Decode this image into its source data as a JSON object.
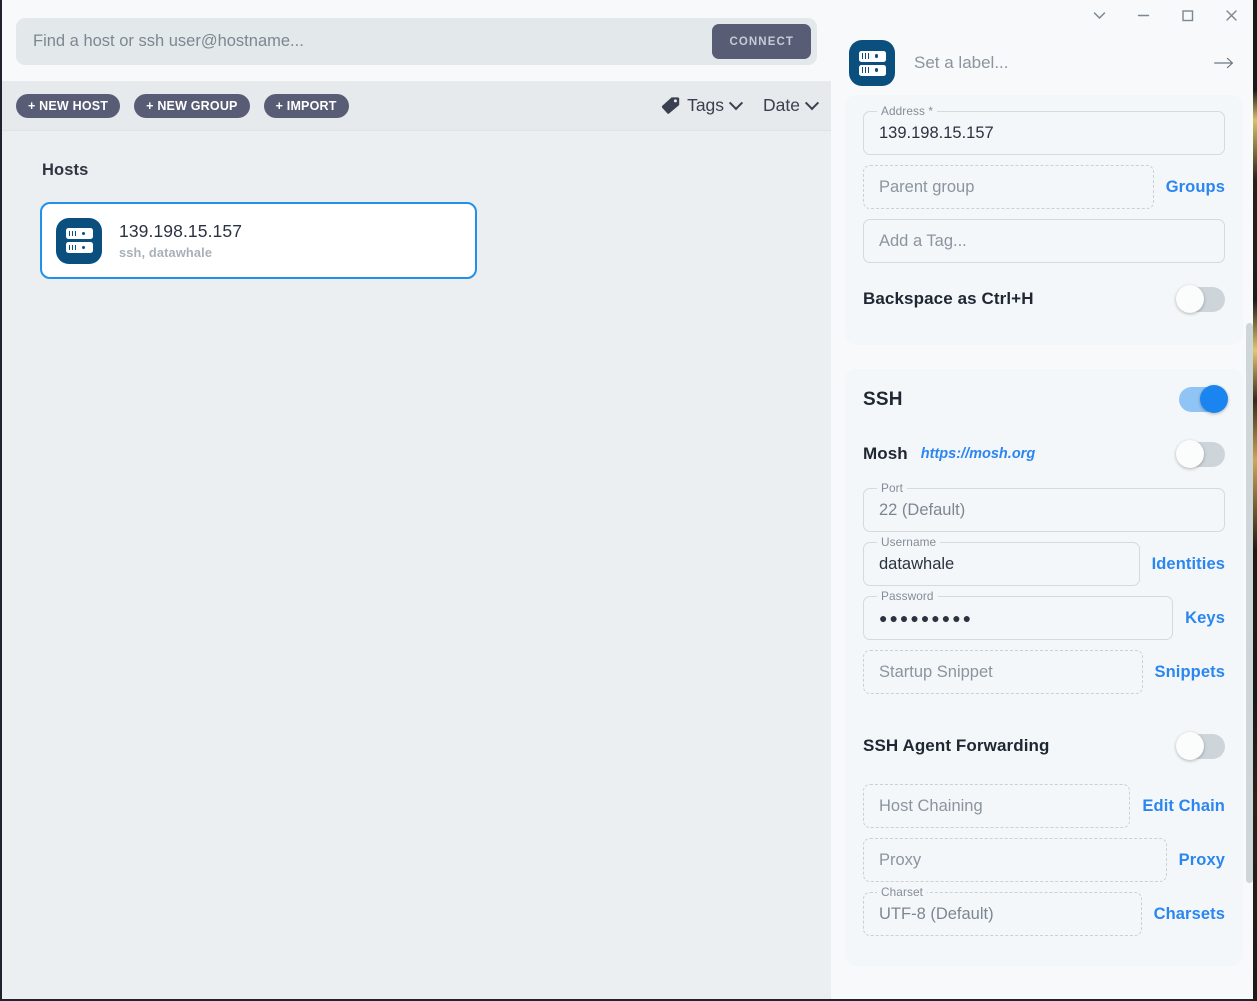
{
  "left": {
    "search": {
      "placeholder": "Find a host or ssh user@hostname...",
      "value": "",
      "connect_label": "CONNECT"
    },
    "toolbar": {
      "new_host": "+ NEW HOST",
      "new_group": "+ NEW GROUP",
      "import": "+ IMPORT",
      "tags_label": "Tags",
      "date_label": "Date"
    },
    "hosts_section_title": "Hosts",
    "hosts": [
      {
        "title": "139.198.15.157",
        "subtitle": "ssh, datawhale",
        "icon": "server-icon",
        "selected": true
      }
    ]
  },
  "right": {
    "titlebar": {
      "collapse_icon": "chevron-down-icon",
      "minimize_icon": "minimize-icon",
      "maximize_icon": "maximize-icon",
      "close_icon": "close-icon"
    },
    "header": {
      "icon": "server-icon",
      "label_placeholder": "Set a label...",
      "label_value": "",
      "submit_icon": "arrow-right-icon"
    },
    "general_card": {
      "address": {
        "legend": "Address *",
        "value": "139.198.15.157"
      },
      "parent_group": {
        "placeholder": "Parent group",
        "value": "",
        "link": "Groups"
      },
      "tag": {
        "placeholder": "Add a Tag...",
        "value": ""
      },
      "backspace_toggle": {
        "label": "Backspace as Ctrl+H",
        "state": "off"
      }
    },
    "ssh_card": {
      "ssh": {
        "label": "SSH",
        "state": "on"
      },
      "mosh": {
        "label": "Mosh",
        "link_text": "https://mosh.org",
        "state": "off"
      },
      "port": {
        "legend": "Port",
        "value": "22 (Default)"
      },
      "username": {
        "legend": "Username",
        "value": "datawhale",
        "link": "Identities"
      },
      "password": {
        "legend": "Password",
        "value": "●●●●●●●●●",
        "link": "Keys"
      },
      "startup_snippet": {
        "placeholder": "Startup Snippet",
        "value": "",
        "link": "Snippets"
      },
      "agent_forwarding": {
        "label": "SSH Agent Forwarding",
        "state": "off"
      },
      "host_chaining": {
        "placeholder": "Host Chaining",
        "value": "",
        "link": "Edit Chain"
      },
      "proxy": {
        "placeholder": "Proxy",
        "value": "",
        "link": "Proxy"
      },
      "charset": {
        "legend": "Charset",
        "value": "UTF-8 (Default)",
        "link": "Charsets"
      }
    }
  },
  "colors": {
    "accent_blue": "#2b86f0",
    "icon_navy": "#0b4f7f",
    "pill_gray": "#585d75",
    "panel_bg": "#f7f9fa",
    "left_bg": "#eceff1"
  }
}
